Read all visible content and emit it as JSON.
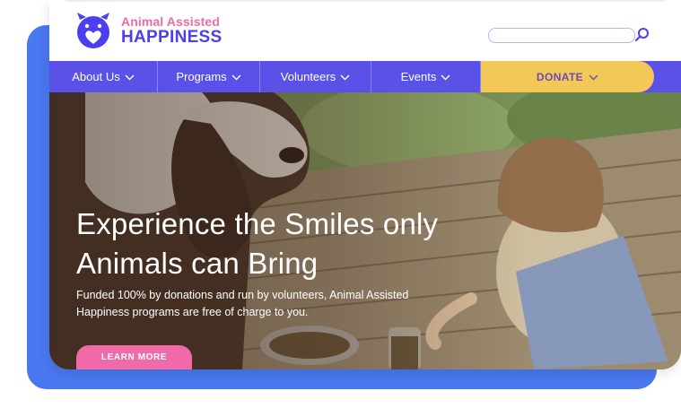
{
  "brand": {
    "line1": "Animal Assisted",
    "line2": "HAPPINESS"
  },
  "search": {
    "placeholder": ""
  },
  "nav": {
    "items": [
      {
        "label": "About Us"
      },
      {
        "label": "Programs"
      },
      {
        "label": "Volunteers"
      },
      {
        "label": "Events"
      }
    ],
    "donate_label": "DONATE"
  },
  "hero": {
    "headline_line1": "Experience the Smiles only",
    "headline_line2": "Animals can Bring",
    "subtext_line1": "Funded 100% by donations and run by volunteers, Animal Assisted",
    "subtext_line2": "Happiness programs are free of charge to you.",
    "cta_label": "LEARN MORE"
  },
  "colors": {
    "accent_blue": "#4a78f0",
    "nav_purple": "#5a52e8",
    "donate_yellow": "#f4c857",
    "brand_pink": "#f06aa7",
    "brand_indigo": "#4b3ff0"
  },
  "icons": {
    "logo": "pig-heart-logo-icon",
    "search": "search-icon",
    "dropdown": "chevron-down-icon"
  }
}
